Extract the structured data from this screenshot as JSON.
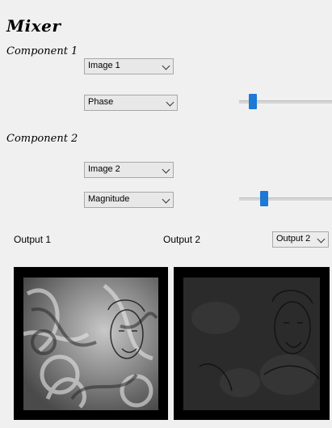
{
  "mixer": {
    "title": "Mixer"
  },
  "component1": {
    "title": "Component 1",
    "image_select": "Image 1",
    "mode_select": "Phase",
    "slider_value": 0.1
  },
  "component2": {
    "title": "Component 2",
    "image_select": "Image 2",
    "mode_select": "Magnitude",
    "slider_value": 0.27
  },
  "outputs": {
    "output1_label": "Output 1",
    "output2_label": "Output 2",
    "output_select": "Output 2"
  },
  "colors": {
    "slider_thumb": "#1e78d6",
    "frame": "#000000"
  }
}
